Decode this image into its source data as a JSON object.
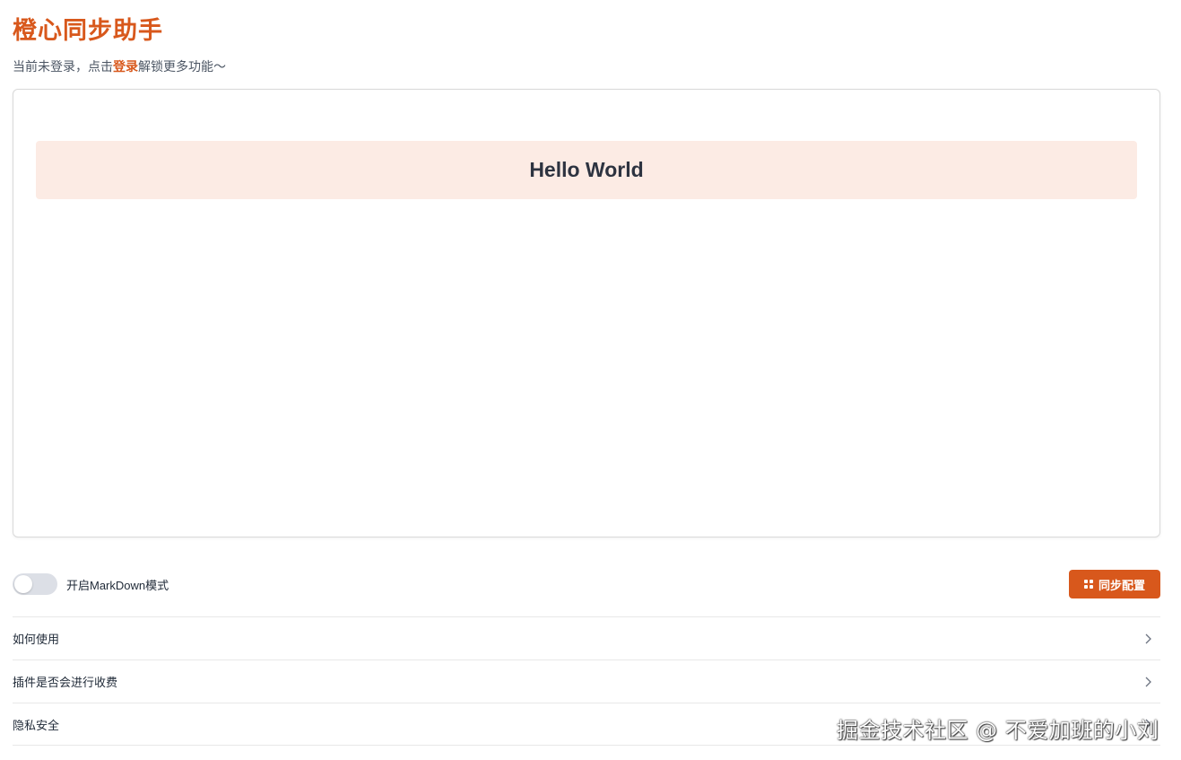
{
  "app": {
    "title": "橙心同步助手"
  },
  "login_hint": {
    "prefix": "当前未登录，点击",
    "link": "登录",
    "suffix": "解锁更多功能～"
  },
  "editor": {
    "preview_heading": "Hello World"
  },
  "controls": {
    "markdown_toggle": {
      "label": "开启MarkDown模式",
      "on": false
    },
    "sync_button": {
      "label": "同步配置",
      "icon": "grid-icon"
    }
  },
  "faq": {
    "items": [
      {
        "label": "如何使用",
        "icon": "chevron-right-icon"
      },
      {
        "label": "插件是否会进行收费",
        "icon": "chevron-right-icon"
      },
      {
        "label": "隐私安全",
        "icon": "chevron-right-icon"
      }
    ]
  },
  "watermark": "掘金技术社区 @ 不爱加班的小刘",
  "colors": {
    "accent": "#d8581c",
    "preview_bg": "#fcebe4",
    "toggle_off": "#dcdfe6"
  }
}
